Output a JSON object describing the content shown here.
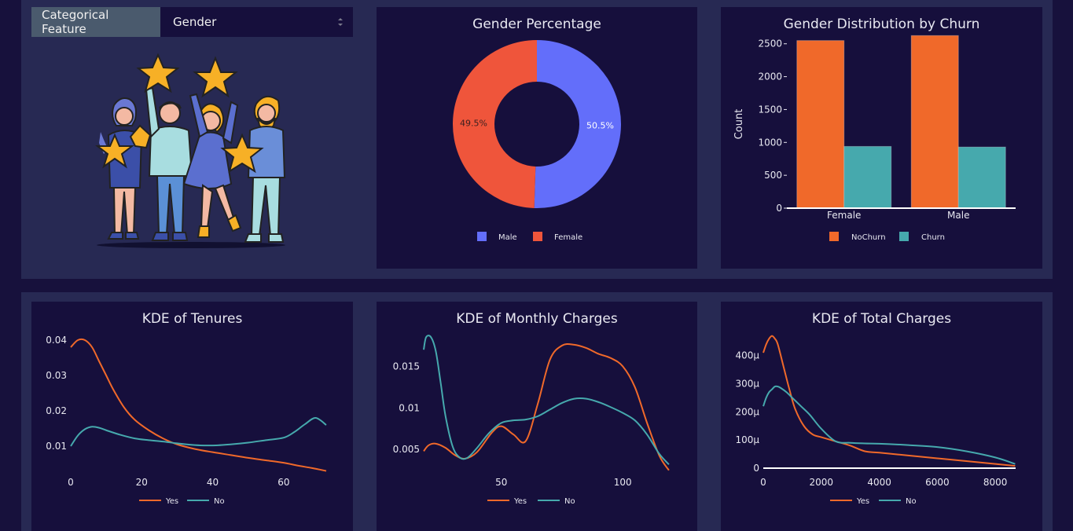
{
  "selector": {
    "label": "Categorical Feature",
    "value": "Gender"
  },
  "colors": {
    "page_bg": "#17113c",
    "card_bg": "#272953",
    "panel_bg": "#160f3c",
    "orange": "#f0692a",
    "teal": "#46a9ad",
    "male": "#636efa",
    "female": "#ef553b"
  },
  "illustration": {
    "icon": "people-holding-stars-illustration"
  },
  "chart_data": [
    {
      "type": "pie",
      "title": "Gender Percentage",
      "hole": true,
      "labels": [
        "Male",
        "Female"
      ],
      "values": [
        50.5,
        49.5
      ],
      "value_labels": [
        "50.5%",
        "49.5%"
      ],
      "legend": {
        "placement": "bottom",
        "entries": [
          "Male",
          "Female"
        ]
      }
    },
    {
      "type": "bar",
      "title": "Gender Distribution by Churn",
      "ylabel": "Count",
      "xlabel": "",
      "categories": [
        "Female",
        "Male"
      ],
      "ylim": [
        0,
        2700
      ],
      "yticks": [
        0,
        500,
        1000,
        1500,
        2000,
        2500
      ],
      "series": [
        {
          "name": "NoChurn",
          "values": [
            2549,
            2625
          ]
        },
        {
          "name": "Churn",
          "values": [
            939,
            930
          ]
        }
      ],
      "legend": {
        "placement": "bottom"
      }
    },
    {
      "type": "line",
      "title": "KDE of Tenures",
      "xlim": [
        0,
        72
      ],
      "ylim": [
        0.002,
        0.042
      ],
      "xticks": [
        "0",
        "20",
        "40",
        "60"
      ],
      "xtick_values": [
        0,
        20,
        40,
        60
      ],
      "yticks": [
        "0.01",
        "0.02",
        "0.03",
        "0.04"
      ],
      "ytick_values": [
        0.01,
        0.02,
        0.03,
        0.04
      ],
      "series": [
        {
          "name": "Yes",
          "x": [
            0,
            2,
            4,
            6,
            8,
            10,
            12,
            15,
            18,
            22,
            26,
            30,
            35,
            40,
            45,
            50,
            55,
            60,
            64,
            68,
            72
          ],
          "y": [
            0.038,
            0.04,
            0.04,
            0.038,
            0.034,
            0.03,
            0.026,
            0.021,
            0.0175,
            0.0145,
            0.0122,
            0.0105,
            0.0092,
            0.0083,
            0.0075,
            0.0067,
            0.006,
            0.0053,
            0.0045,
            0.0038,
            0.003
          ]
        },
        {
          "name": "No",
          "x": [
            0,
            2,
            4,
            6,
            8,
            10,
            14,
            18,
            22,
            26,
            30,
            35,
            40,
            45,
            50,
            55,
            60,
            63,
            66,
            69,
            72
          ],
          "y": [
            0.01,
            0.013,
            0.0148,
            0.0155,
            0.0152,
            0.0145,
            0.0132,
            0.0122,
            0.0117,
            0.0113,
            0.0108,
            0.0103,
            0.0102,
            0.0105,
            0.011,
            0.0117,
            0.0124,
            0.014,
            0.0162,
            0.018,
            0.016
          ]
        }
      ],
      "legend": {
        "placement": "bottom"
      }
    },
    {
      "type": "line",
      "title": "KDE of Monthly Charges",
      "xlim": [
        18,
        120
      ],
      "ylim": [
        0.002,
        0.019
      ],
      "xticks": [
        "50",
        "100"
      ],
      "xtick_values": [
        50,
        100
      ],
      "yticks": [
        "0.005",
        "0.01",
        "0.015"
      ],
      "ytick_values": [
        0.005,
        0.01,
        0.015
      ],
      "series": [
        {
          "name": "Yes",
          "x": [
            18,
            20,
            23,
            27,
            31,
            35,
            40,
            46,
            50,
            55,
            60,
            65,
            70,
            75,
            80,
            85,
            90,
            95,
            100,
            105,
            110,
            115,
            119
          ],
          "y": [
            0.0048,
            0.0055,
            0.0057,
            0.0052,
            0.0043,
            0.0039,
            0.0047,
            0.007,
            0.0078,
            0.0068,
            0.006,
            0.0105,
            0.0158,
            0.0175,
            0.0176,
            0.0172,
            0.0165,
            0.016,
            0.015,
            0.0125,
            0.0082,
            0.0043,
            0.0025
          ]
        },
        {
          "name": "No",
          "x": [
            18,
            19,
            21,
            23,
            25,
            27,
            30,
            33,
            36,
            40,
            45,
            50,
            55,
            60,
            65,
            70,
            75,
            80,
            85,
            90,
            95,
            100,
            105,
            110,
            115,
            119
          ],
          "y": [
            0.017,
            0.0185,
            0.0185,
            0.0168,
            0.013,
            0.009,
            0.0053,
            0.004,
            0.004,
            0.0052,
            0.007,
            0.0082,
            0.0085,
            0.0086,
            0.009,
            0.0098,
            0.0106,
            0.0111,
            0.0111,
            0.0107,
            0.0101,
            0.0094,
            0.0085,
            0.0068,
            0.0045,
            0.0032
          ]
        }
      ],
      "legend": {
        "placement": "bottom"
      }
    },
    {
      "type": "line",
      "title": "KDE of Total Charges",
      "xlim": [
        0,
        8700
      ],
      "ylim": [
        0,
        0.00048
      ],
      "xticks": [
        "0",
        "2000",
        "4000",
        "6000",
        "8000"
      ],
      "xtick_values": [
        0,
        2000,
        4000,
        6000,
        8000
      ],
      "yticks": [
        "0",
        "100μ",
        "200μ",
        "300μ",
        "400μ"
      ],
      "ytick_values": [
        0,
        0.0001,
        0.0002,
        0.0003,
        0.0004
      ],
      "series": [
        {
          "name": "Yes",
          "x": [
            0,
            100,
            200,
            300,
            400,
            500,
            700,
            900,
            1100,
            1400,
            1700,
            2000,
            2500,
            3000,
            3500,
            4000,
            5000,
            6000,
            7000,
            8000,
            8684
          ],
          "y": [
            0.00041,
            0.00044,
            0.00046,
            0.00047,
            0.00046,
            0.00044,
            0.00036,
            0.00028,
            0.00021,
            0.00015,
            0.00012,
            0.00011,
            9.5e-05,
            8e-05,
            6e-05,
            5.5e-05,
            4.5e-05,
            3.5e-05,
            2.5e-05,
            1.5e-05,
            8e-06
          ]
        },
        {
          "name": "No",
          "x": [
            0,
            100,
            200,
            300,
            400,
            500,
            600,
            800,
            1000,
            1300,
            1600,
            2000,
            2500,
            3000,
            3500,
            4000,
            5000,
            6000,
            7000,
            8000,
            8684
          ],
          "y": [
            0.00022,
            0.00025,
            0.00027,
            0.00028,
            0.00029,
            0.00029,
            0.000285,
            0.00027,
            0.00025,
            0.00022,
            0.00019,
            0.00014,
            9.5e-05,
            9e-05,
            8.8e-05,
            8.7e-05,
            8.2e-05,
            7.5e-05,
            6e-05,
            3.8e-05,
            1.5e-05
          ]
        }
      ],
      "legend": {
        "placement": "bottom"
      }
    }
  ]
}
